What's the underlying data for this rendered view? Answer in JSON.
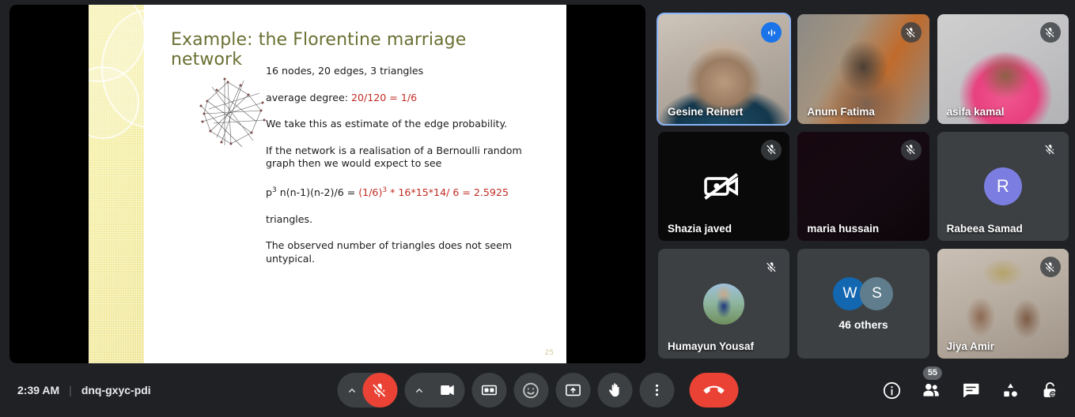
{
  "meeting": {
    "time": "2:39 AM",
    "separator": "|",
    "code": "dnq-gxyc-pdi"
  },
  "slide": {
    "title": "Example: the Florentine marriage network",
    "number": "25",
    "accent_color": "#6b7033",
    "highlight_color": "#c02b22",
    "graph_caption": "florentine-marriage-network-graph",
    "lines": {
      "l1": "16 nodes, 20 edges, 3 triangles",
      "l2_label": "average degree: ",
      "l2_value": "20/120 = 1/6",
      "l3": "We take this as estimate of the edge probability.",
      "l4": "If the network is a realisation of a Bernoulli random graph then we would expect to see",
      "l5_a": "p",
      "l5_a_sup": "3",
      "l5_b": " n(n-1)(n-2)/6 = ",
      "l5_c": "(1/6)",
      "l5_c_sup": "3",
      "l5_d": " * 16*15*14/ 6 = 2.5925",
      "l6": "triangles.",
      "l7": "The observed number of triangles does not seem untypical."
    }
  },
  "participants": [
    {
      "name": "Gesine Reinert",
      "state": "speaking",
      "badge": "audio-level-icon",
      "video": "v-gesine",
      "speaking": true
    },
    {
      "name": "Anum Fatima",
      "state": "muted",
      "badge": "mic-off-icon",
      "video": "v-anum",
      "speaking": false
    },
    {
      "name": "asifa kamal",
      "state": "muted",
      "badge": "mic-off-icon",
      "video": "v-asifa",
      "speaking": false
    },
    {
      "name": "Shazia javed",
      "state": "muted",
      "badge": "mic-off-icon",
      "video": "v-shazia",
      "speaking": false,
      "center_icon": "camera-off-icon"
    },
    {
      "name": "maria hussain",
      "state": "muted",
      "badge": "mic-off-icon",
      "video": "v-maria",
      "speaking": false
    },
    {
      "name": "Rabeea Samad",
      "state": "muted",
      "badge": "mic-off-icon",
      "avatar_initial": "R",
      "avatar_color": "#7b7ee0",
      "speaking": false
    },
    {
      "name": "Humayun Yousaf",
      "state": "muted",
      "badge": "mic-off-icon",
      "photo": "ph-humayun",
      "speaking": false
    },
    {
      "name": "46 others",
      "state": "overflow",
      "avatars": [
        {
          "initial": "W",
          "color": "#1267b0"
        },
        {
          "initial": "S",
          "color": "#5f7d8c"
        }
      ],
      "speaking": false
    },
    {
      "name": "Jiya Amir",
      "state": "muted",
      "badge": "mic-off-icon",
      "video": "v-jiya",
      "speaking": false
    }
  ],
  "controls": [
    {
      "name": "microphone-toggle",
      "label": "Turn on microphone",
      "icon": "mic-off-icon",
      "state": "muted",
      "has_chevron": true
    },
    {
      "name": "camera-toggle",
      "label": "Turn off camera",
      "icon": "camera-icon",
      "state": "on",
      "has_chevron": true
    },
    {
      "name": "captions-toggle",
      "label": "Turn on captions",
      "icon": "closed-caption-icon",
      "state": "off",
      "has_chevron": false
    },
    {
      "name": "reactions-button",
      "label": "Send a reaction",
      "icon": "emoji-icon",
      "state": "off",
      "has_chevron": false
    },
    {
      "name": "present-button",
      "label": "Present now",
      "icon": "present-screen-icon",
      "state": "off",
      "has_chevron": false
    },
    {
      "name": "raise-hand-button",
      "label": "Raise hand",
      "icon": "raised-hand-icon",
      "state": "off",
      "has_chevron": false
    },
    {
      "name": "more-options-button",
      "label": "More options",
      "icon": "more-vert-icon",
      "state": "off",
      "has_chevron": false
    },
    {
      "name": "leave-call-button",
      "label": "Leave call",
      "icon": "end-call-icon",
      "state": "danger",
      "has_chevron": false
    }
  ],
  "right_icons": [
    {
      "name": "meeting-details-icon",
      "label": "Meeting details",
      "count": null
    },
    {
      "name": "people-icon",
      "label": "Show everyone",
      "count": "55"
    },
    {
      "name": "chat-icon",
      "label": "Chat with everyone",
      "count": null
    },
    {
      "name": "activities-icon",
      "label": "Activities",
      "count": null
    },
    {
      "name": "host-controls-icon",
      "label": "Host controls",
      "count": null
    }
  ],
  "colors": {
    "accent_blue": "#8ab4f8",
    "speaking_blue": "#1a73e8",
    "danger_red": "#ea4335",
    "surface": "#3c4043",
    "background": "#202124"
  }
}
